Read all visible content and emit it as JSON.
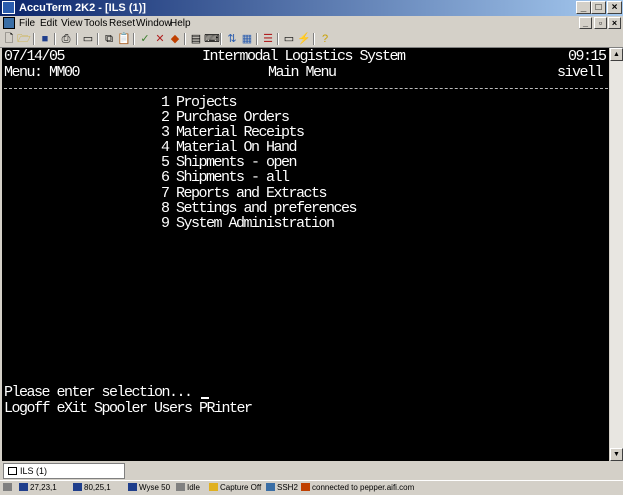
{
  "window": {
    "title": "AccuTerm 2K2 - [ILS (1)]"
  },
  "menu": [
    "File",
    "Edit",
    "View",
    "Tools",
    "Reset",
    "Window",
    "Help"
  ],
  "terminal": {
    "header_left": "07/14/05",
    "header_center": "Intermodal Logistics System",
    "header_right": "09:15",
    "menu_id": "Menu: MM00",
    "menu_title": "Main Menu",
    "user": "sivell",
    "options": [
      "1 Projects",
      "2 Purchase Orders",
      "3 Material Receipts",
      "4 Material On Hand",
      "5 Shipments - open",
      "6 Shipments - all",
      "7 Reports and Extracts",
      "8 Settings and preferences",
      "9 System Administration"
    ],
    "prompt": "Please enter selection...",
    "commands": "Logoff eXit Spooler Users PRinter"
  },
  "tabs": [
    "ILS (1)"
  ],
  "status": {
    "cursor": "27,23,1",
    "screen": "80,25,1",
    "emulation": "Wyse 50",
    "printer": "Idle",
    "capture": "Capture Off",
    "protocol": "SSH2",
    "connection": "connected to pepper.aifi.com"
  }
}
